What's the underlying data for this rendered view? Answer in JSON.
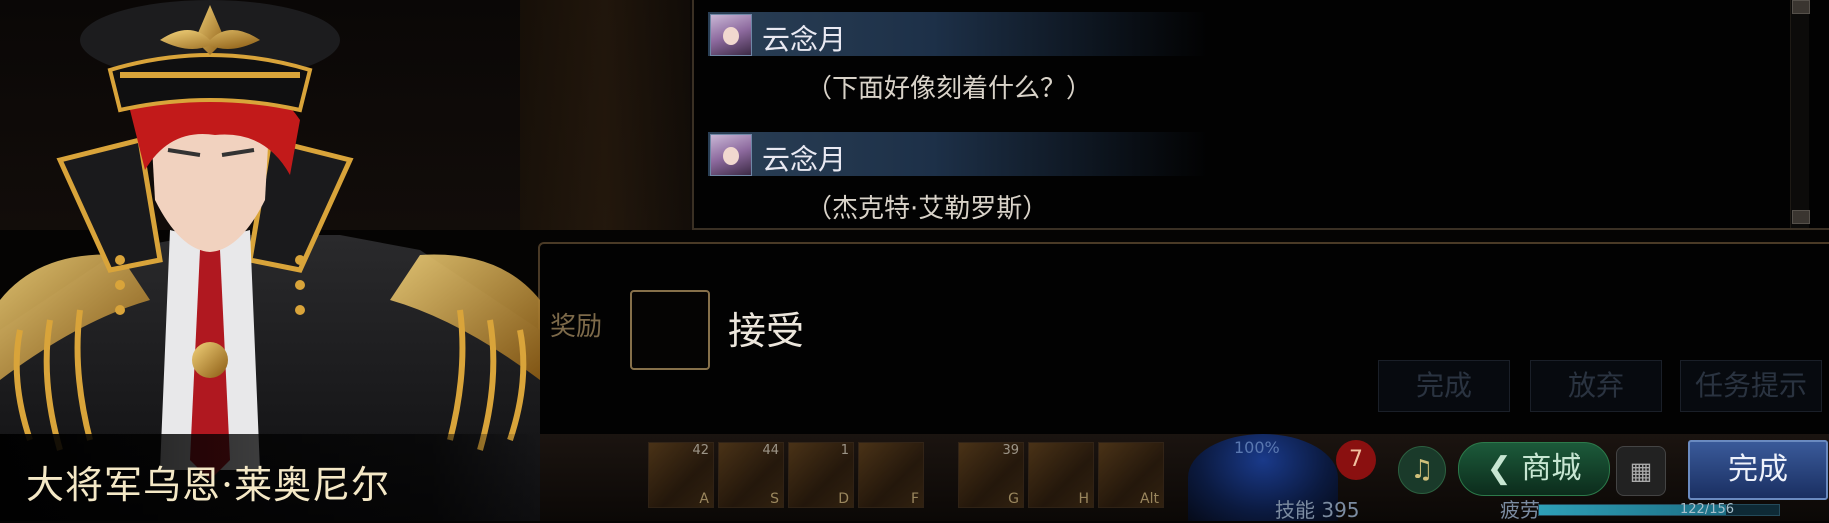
{
  "npc": {
    "name": "大将军乌恩·莱奥尼尔"
  },
  "dialog": {
    "messages": [
      {
        "speaker": "云念月",
        "text": "（下面好像刻着什么？）"
      },
      {
        "speaker": "云念月",
        "text": "（杰克特·艾勒罗斯）"
      }
    ]
  },
  "reward": {
    "label": "奖励",
    "accept_label": "接受"
  },
  "quest_buttons": {
    "complete": "完成",
    "abandon": "放弃",
    "hint": "任务提示"
  },
  "skills": [
    {
      "count": "42",
      "key": "A"
    },
    {
      "count": "44",
      "key": "S"
    },
    {
      "count": "1",
      "key": "D"
    },
    {
      "count": "",
      "key": "F"
    },
    {
      "count": "39",
      "key": "G"
    },
    {
      "count": "",
      "key": "H"
    },
    {
      "count": "",
      "key": "Alt"
    }
  ],
  "status": {
    "skill_points_label": "技能 395",
    "fatigue_label": "疲劳",
    "fatigue_value": "122/156",
    "fatigue_fraction": 0.78,
    "orb_text": "100%"
  },
  "hud": {
    "mall_label": "商城",
    "alert_badge": "7",
    "complete_label": "完成"
  },
  "colors": {
    "accent_gold": "#86704a",
    "button_blue": "#1a2f62",
    "name_bar": "#2a3f55"
  }
}
